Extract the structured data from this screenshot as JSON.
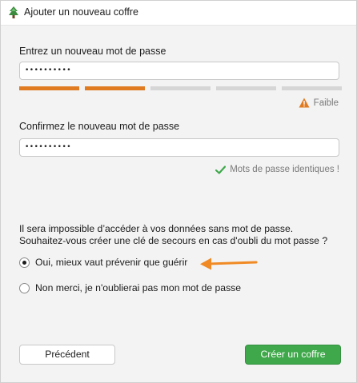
{
  "window": {
    "title": "Ajouter un nouveau coffre",
    "app_icon": "tree-app-icon"
  },
  "new_password": {
    "label": "Entrez un nouveau mot de passe",
    "value": "••••••••••"
  },
  "strength": {
    "segments_filled": 2,
    "segments_total": 5,
    "fill_color": "#e07b22",
    "empty_color": "#d6d6d6",
    "icon": "warning-icon",
    "icon_color": "#e07b22",
    "label": "Faible"
  },
  "confirm_password": {
    "label": "Confirmez le nouveau mot de passe",
    "value": "••••••••••"
  },
  "match": {
    "icon": "checkmark-icon",
    "icon_color": "#3ea84a",
    "label": "Mots de passe identiques !"
  },
  "recovery": {
    "question_line1": "Il sera impossible d’accéder à vos données sans mot de passe.",
    "question_line2": "Souhaitez-vous créer une clé de secours en cas d'oubli du mot passe ?",
    "options": [
      {
        "label": "Oui, mieux vaut prévenir que guérir",
        "checked": true
      },
      {
        "label": "Non merci, je n'oublierai pas mon mot de passe",
        "checked": false
      }
    ]
  },
  "annotation": {
    "icon": "arrow-left-icon",
    "color": "#f08a24"
  },
  "buttons": {
    "previous": "Précédent",
    "create": "Créer un coffre",
    "create_color": "#3ea84a"
  }
}
